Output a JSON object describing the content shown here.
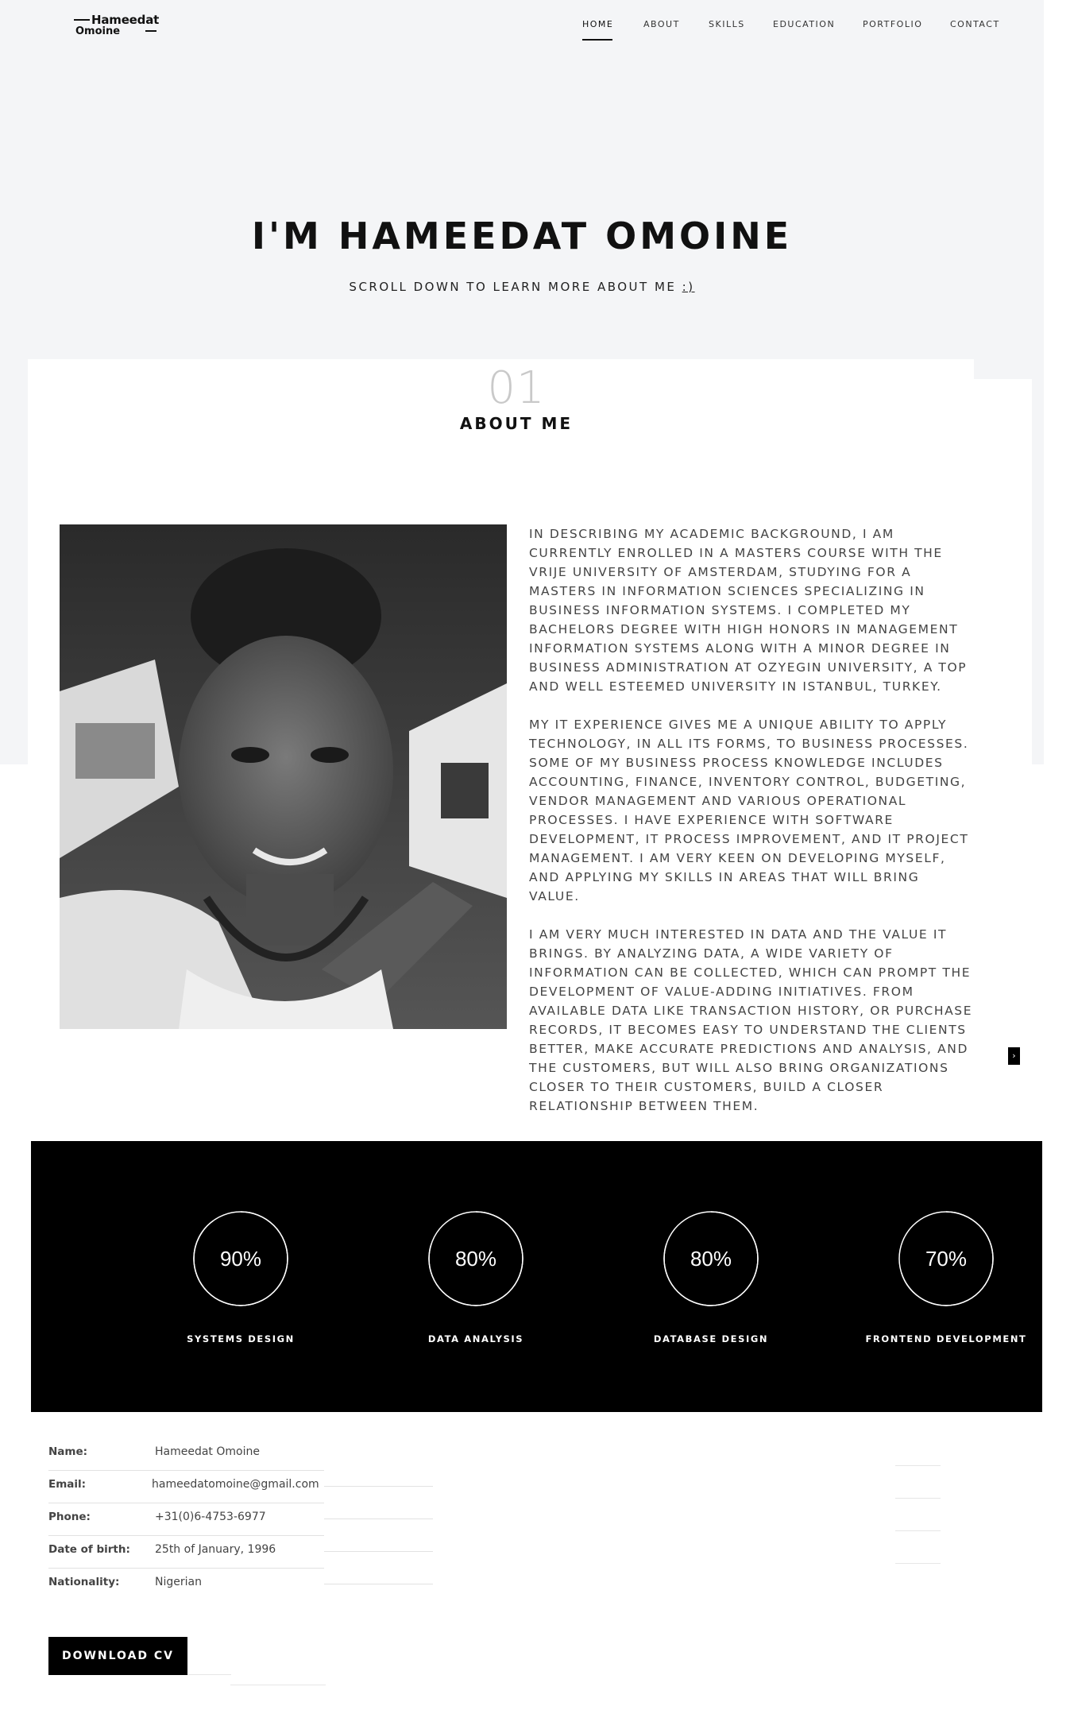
{
  "logo": {
    "line1": "Hameedat",
    "line2": "Omoine"
  },
  "nav": {
    "items": [
      "HOME",
      "ABOUT",
      "SKILLS",
      "EDUCATION",
      "PORTFOLIO",
      "CONTACT"
    ],
    "active": "HOME"
  },
  "hero": {
    "title": "I'M HAMEEDAT OMOINE",
    "subtitle": "SCROLL DOWN TO LEARN MORE ABOUT ME ",
    "smile": ":)"
  },
  "about": {
    "number": "01",
    "title": "ABOUT ME",
    "paragraphs": [
      "In describing my academic background, I am currently enrolled in a masters course with the Vrije University of Amsterdam, studying for a masters in Information Sciences specializing in Business Information Systems. I completed my Bachelors degree with high honors in Management Information Systems along with a minor degree in Business Administration at Ozyegin University, a top and well esteemed university in Istanbul, Turkey.",
      "My IT experience gives me a unique ability to apply technology, in all its forms, to business processes. Some of my business process knowledge includes accounting, finance, inventory control, budgeting, vendor management and various operational processes. I have experience with software development, IT process improvement, and IT project management. I am very keen on developing myself, and applying my skills in areas that will bring value.",
      "I am very much interested in data and the value it brings. By analyzing data, a wide variety of information can be collected, which can prompt the development of value-adding initiatives. From available data like transaction history, or purchase records, it becomes easy to understand the clients better, make accurate predictions and analysis, and the customers, but will also bring organizations closer to their customers, build a closer relationship between them."
    ]
  },
  "skills": [
    {
      "percent": "90%",
      "value": 90,
      "label": "SYSTEMS DESIGN"
    },
    {
      "percent": "80%",
      "value": 80,
      "label": "DATA ANALYSIS"
    },
    {
      "percent": "80%",
      "value": 80,
      "label": "DATABASE DESIGN"
    },
    {
      "percent": "70%",
      "value": 70,
      "label": "FRONTEND DEVELOPMENT"
    }
  ],
  "details": {
    "name_label": "Name:",
    "name": "Hameedat Omoine",
    "email_label": "Email:",
    "email": "hameedatomoine@gmail.com",
    "phone_label": "Phone:",
    "phone": "+31(0)6-4753-6977",
    "dob_label": "Date of birth:",
    "dob": "25th of January, 1996",
    "nationality_label": "Nationality:",
    "nationality": "Nigerian"
  },
  "download_label": "DOWNLOAD CV",
  "colors": {
    "accent": "#000000",
    "background": "#f4f5f7"
  }
}
